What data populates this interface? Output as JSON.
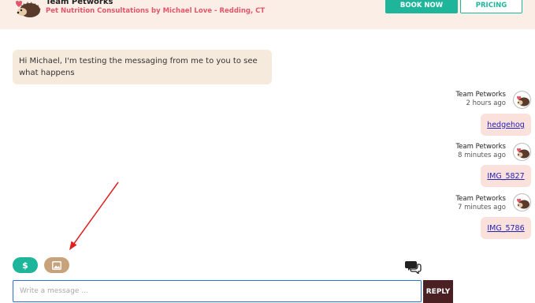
{
  "header": {
    "team_name": "Team Petworks",
    "subtitle": "Pet Nutrition Consultations by Michael Love - Redding, CT",
    "book_now_label": "BOOK NOW",
    "pricing_label": "PRICING"
  },
  "conversation": {
    "incoming": {
      "text": "Hi Michael, I'm testing the messaging from me to you to see what happens"
    },
    "outgoing": [
      {
        "sender": "Team Petworks",
        "time": "2 hours ago",
        "attachment": "hedgehog"
      },
      {
        "sender": "Team Petworks",
        "time": "8 minutes ago",
        "attachment": "IMG_5827"
      },
      {
        "sender": "Team Petworks",
        "time": "7 minutes ago",
        "attachment": "IMG_5786"
      }
    ]
  },
  "composer": {
    "pay_icon": "dollar-icon",
    "image_icon": "image-icon",
    "chat_icon": "chat-bubbles-icon",
    "placeholder": "Write a message ...",
    "value": "",
    "reply_label": "REPLY"
  },
  "colors": {
    "header_bg": "#fbeee6",
    "accent_teal": "#1fb59a",
    "subtitle_red": "#e0566a",
    "incoming_bubble": "#f6eadc",
    "outgoing_bubble": "#fbe1dc",
    "reply_button": "#4a2022",
    "annotation_arrow": "#e02020"
  }
}
